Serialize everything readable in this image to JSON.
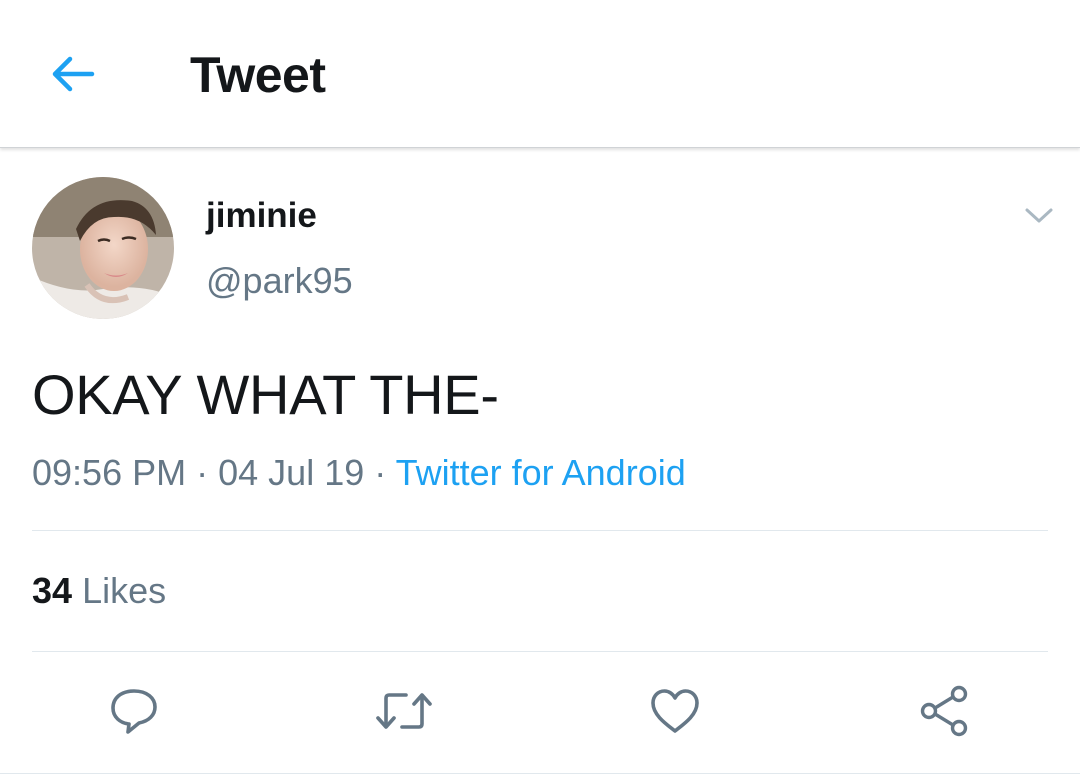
{
  "header": {
    "title": "Tweet",
    "back_icon": "arrow-left-icon"
  },
  "tweet": {
    "author": {
      "display_name": "jiminie",
      "handle": "@park95",
      "avatar_icon": "profile-photo"
    },
    "text": "OKAY WHAT THE-",
    "time": "09:56 PM",
    "separator": "·",
    "date": "04 Jul 19",
    "source": "Twitter for Android",
    "menu_icon": "chevron-down-icon"
  },
  "stats": {
    "likes_count": "34",
    "likes_label": "Likes"
  },
  "actions": [
    {
      "name": "reply",
      "icon": "reply-icon"
    },
    {
      "name": "retweet",
      "icon": "retweet-icon"
    },
    {
      "name": "like",
      "icon": "heart-icon"
    },
    {
      "name": "share",
      "icon": "share-icon"
    }
  ],
  "colors": {
    "accent": "#1da1f2",
    "text_primary": "#14171a",
    "text_secondary": "#657786",
    "divider": "#e1e8ed"
  }
}
